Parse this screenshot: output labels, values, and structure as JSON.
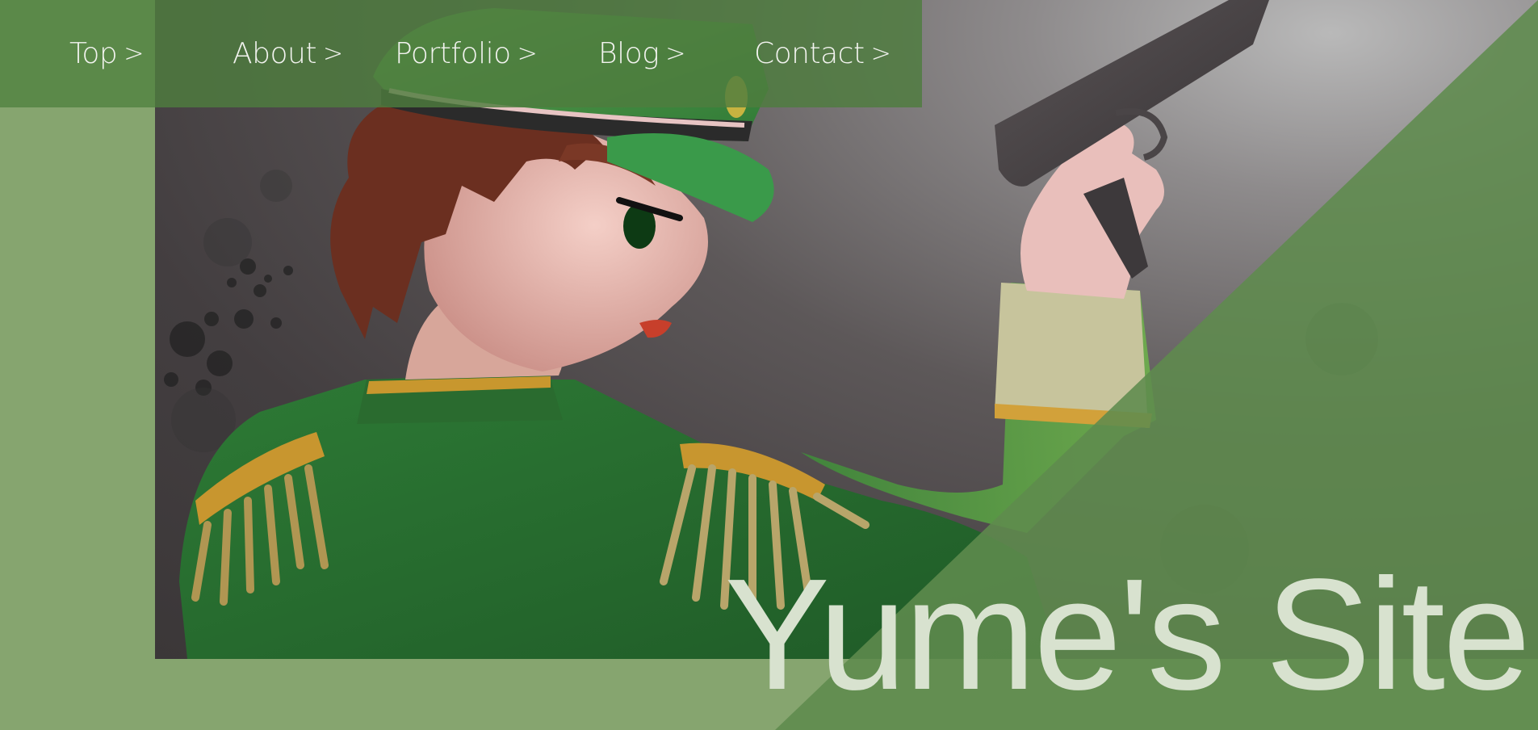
{
  "nav": {
    "items": [
      {
        "label": "Top",
        "chevron": ">"
      },
      {
        "label": "About",
        "chevron": ">"
      },
      {
        "label": "Portfolio",
        "chevron": ">"
      },
      {
        "label": "Blog",
        "chevron": ">"
      },
      {
        "label": "Contact",
        "chevron": ">"
      }
    ]
  },
  "hero": {
    "title": "Yume's Site",
    "image_icon": "illustration-icon"
  },
  "colors": {
    "page_background": "#86a56f",
    "nav_background": "#4e7c3e",
    "diagonal_overlay": "#5f8b4d",
    "title_text": "#d8e2cf",
    "nav_text": "#f2f3ef"
  }
}
